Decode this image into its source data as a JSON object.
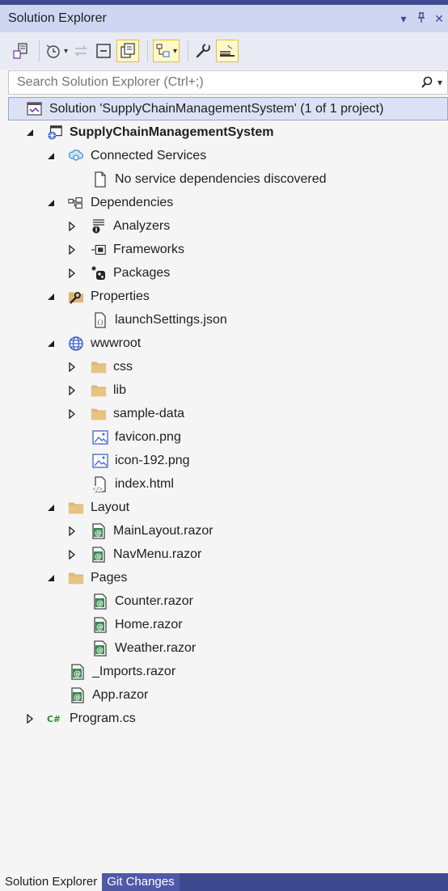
{
  "panel": {
    "title": "Solution Explorer",
    "dropdown_glyph": "▾",
    "pin_glyph": "╷",
    "close_glyph": "✕"
  },
  "search": {
    "placeholder": "Search Solution Explorer (Ctrl+;)"
  },
  "tree": [
    {
      "id": "solution",
      "label": "Solution 'SupplyChainManagementSystem' (1 of 1 project)",
      "arrow": "none",
      "icon": "solution-icon",
      "selected": true
    },
    {
      "id": "project",
      "label": "SupplyChainManagementSystem",
      "arrow": "expanded",
      "icon": "project-icon",
      "bold": true
    },
    {
      "id": "connected-services",
      "label": "Connected Services",
      "arrow": "expanded",
      "icon": "connected-services-icon"
    },
    {
      "id": "no-service",
      "label": "No service dependencies discovered",
      "arrow": "none",
      "icon": "document-icon"
    },
    {
      "id": "dependencies",
      "label": "Dependencies",
      "arrow": "expanded",
      "icon": "dependencies-icon"
    },
    {
      "id": "analyzers",
      "label": "Analyzers",
      "arrow": "collapsed",
      "icon": "analyzers-icon"
    },
    {
      "id": "frameworks",
      "label": "Frameworks",
      "arrow": "collapsed",
      "icon": "frameworks-icon"
    },
    {
      "id": "packages",
      "label": "Packages",
      "arrow": "collapsed",
      "icon": "packages-icon"
    },
    {
      "id": "properties",
      "label": "Properties",
      "arrow": "expanded",
      "icon": "properties-folder-icon"
    },
    {
      "id": "launchsettings",
      "label": "launchSettings.json",
      "arrow": "none",
      "icon": "json-file-icon"
    },
    {
      "id": "wwwroot",
      "label": "wwwroot",
      "arrow": "expanded",
      "icon": "globe-icon"
    },
    {
      "id": "css",
      "label": "css",
      "arrow": "collapsed",
      "icon": "folder-icon"
    },
    {
      "id": "lib",
      "label": "lib",
      "arrow": "collapsed",
      "icon": "folder-icon"
    },
    {
      "id": "sample-data",
      "label": "sample-data",
      "arrow": "collapsed",
      "icon": "folder-icon"
    },
    {
      "id": "favicon",
      "label": "favicon.png",
      "arrow": "none",
      "icon": "image-file-icon"
    },
    {
      "id": "icon192",
      "label": "icon-192.png",
      "arrow": "none",
      "icon": "image-file-icon"
    },
    {
      "id": "index",
      "label": "index.html",
      "arrow": "none",
      "icon": "html-file-icon"
    },
    {
      "id": "layout",
      "label": "Layout",
      "arrow": "expanded",
      "icon": "folder-icon"
    },
    {
      "id": "mainlayout",
      "label": "MainLayout.razor",
      "arrow": "collapsed",
      "icon": "razor-file-icon"
    },
    {
      "id": "navmenu",
      "label": "NavMenu.razor",
      "arrow": "collapsed",
      "icon": "razor-file-icon"
    },
    {
      "id": "pages",
      "label": "Pages",
      "arrow": "expanded",
      "icon": "folder-icon"
    },
    {
      "id": "counter",
      "label": "Counter.razor",
      "arrow": "none",
      "icon": "razor-file-icon"
    },
    {
      "id": "home",
      "label": "Home.razor",
      "arrow": "none",
      "icon": "razor-file-icon"
    },
    {
      "id": "weather",
      "label": "Weather.razor",
      "arrow": "none",
      "icon": "razor-file-icon"
    },
    {
      "id": "imports",
      "label": "_Imports.razor",
      "arrow": "none",
      "icon": "razor-file-icon"
    },
    {
      "id": "app",
      "label": "App.razor",
      "arrow": "none",
      "icon": "razor-file-icon"
    },
    {
      "id": "program",
      "label": "Program.cs",
      "arrow": "collapsed",
      "icon": "csharp-file-icon"
    }
  ],
  "bottom_tabs": [
    {
      "label": "Solution Explorer",
      "active": true
    },
    {
      "label": "Git Changes",
      "active": false
    }
  ],
  "colors": {
    "accent": "#3e4a8f",
    "title_bar": "#cfd6f2",
    "selection": "#dde1f5",
    "folder": "#dcb67a",
    "razor_green": "#3a8a4f",
    "csharp_green": "#2a8a2a"
  }
}
